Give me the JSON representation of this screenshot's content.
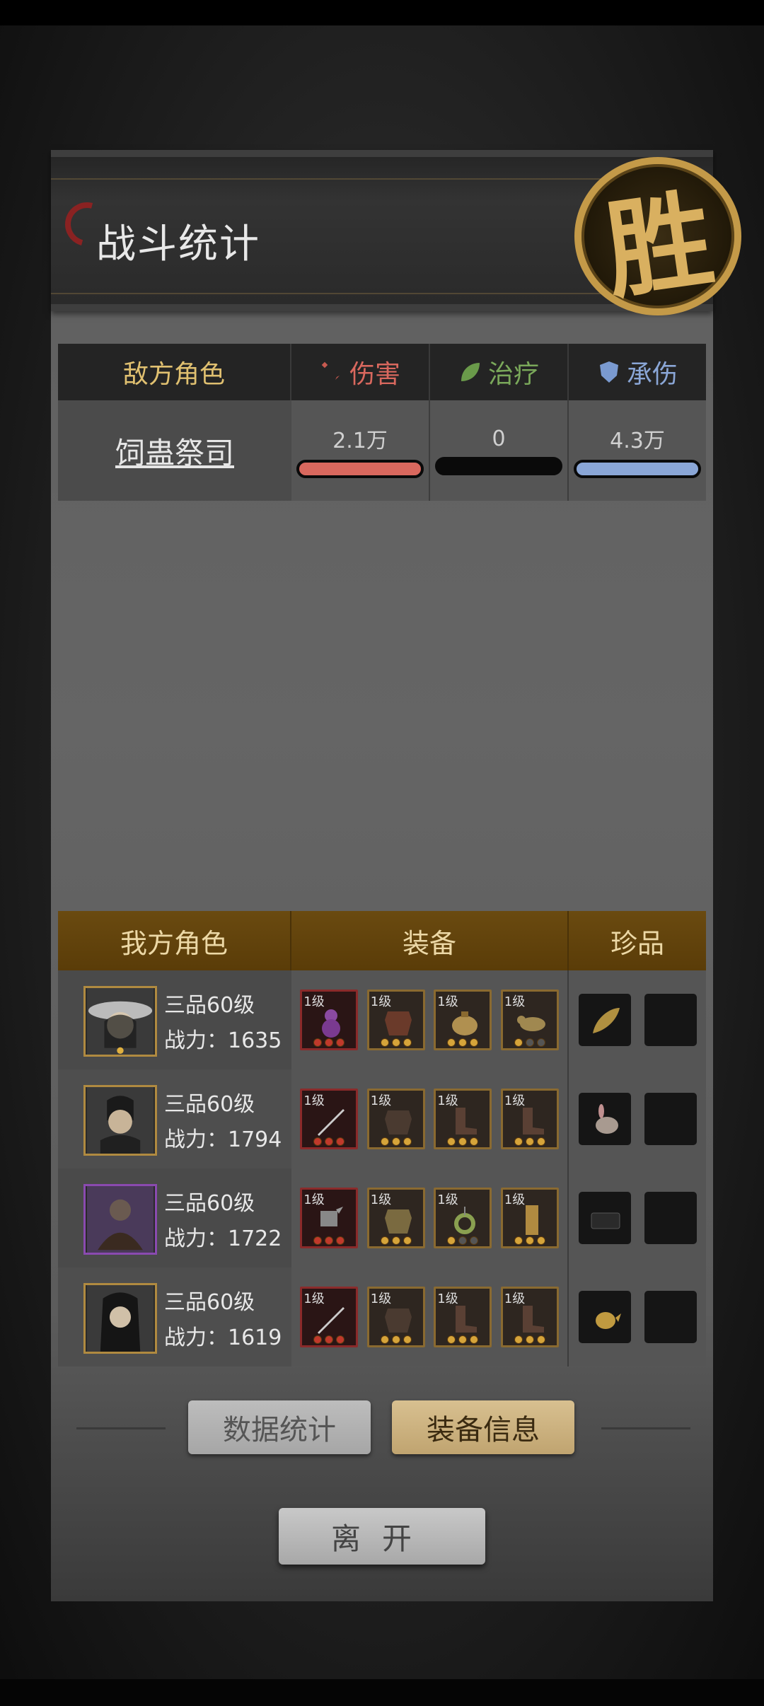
{
  "header": {
    "title": "战斗统计",
    "seal": "胜"
  },
  "enemy_table": {
    "col_name": "敌方角色",
    "col_damage": "伤害",
    "col_heal": "治疗",
    "col_tank": "承伤",
    "rows": [
      {
        "name": "饲蛊祭司",
        "damage": "2.1万",
        "heal": "0",
        "tank": "4.3万",
        "damage_fill": 1.0,
        "heal_fill": 0.0,
        "tank_fill": 1.0
      }
    ]
  },
  "ally_table": {
    "col_name": "我方角色",
    "col_equip": "装备",
    "col_treasure": "珍品",
    "rows": [
      {
        "rank": "三品60级",
        "power": "战力：1635",
        "equip_levels": [
          "1级",
          "1级",
          "1级",
          "1级"
        ]
      },
      {
        "rank": "三品60级",
        "power": "战力：1794",
        "equip_levels": [
          "1级",
          "1级",
          "1级",
          "1级"
        ]
      },
      {
        "rank": "三品60级",
        "power": "战力：1722",
        "equip_levels": [
          "1级",
          "1级",
          "1级",
          "1级"
        ]
      },
      {
        "rank": "三品60级",
        "power": "战力：1619",
        "equip_levels": [
          "1级",
          "1级",
          "1级",
          "1级"
        ]
      }
    ]
  },
  "buttons": {
    "data_stats": "数据统计",
    "equip_info": "装备信息",
    "leave": "离开"
  },
  "colors": {
    "damage": "#d9685e",
    "heal": "#0a0a0a",
    "tank": "#8aa6d6",
    "gold": "#e0c070"
  }
}
